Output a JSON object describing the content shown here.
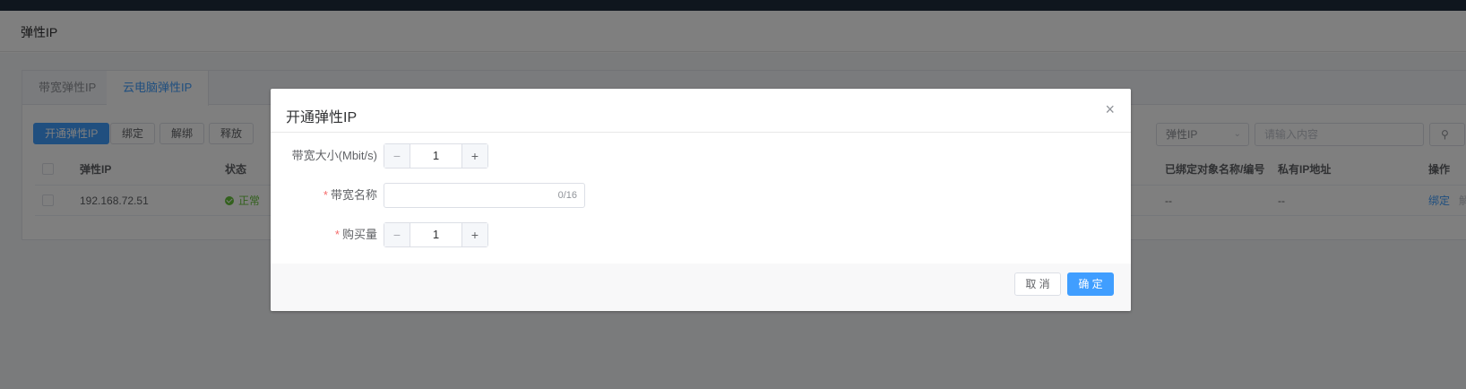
{
  "page": {
    "title": "弹性IP"
  },
  "tabs": [
    {
      "label": "带宽弹性IP",
      "active": false
    },
    {
      "label": "云电脑弹性IP",
      "active": true
    }
  ],
  "toolbar": {
    "open_label": "开通弹性IP",
    "bind_label": "绑定",
    "unbind_label": "解绑",
    "release_label": "释放"
  },
  "filter": {
    "select_value": "弹性IP",
    "search_placeholder": "请输入内容"
  },
  "table": {
    "headers": {
      "ip": "弹性IP",
      "status": "状态",
      "bound_object": "已绑定对象名称/编号",
      "private_ip": "私有IP地址",
      "actions": "操作"
    },
    "rows": [
      {
        "ip": "192.168.72.51",
        "status": "正常",
        "bound_object": "--",
        "private_ip": "--",
        "action_bind": "绑定",
        "action_unbind": "解绑"
      }
    ]
  },
  "dialog": {
    "title": "开通弹性IP",
    "bandwidth_label": "带宽大小(Mbit/s)",
    "bandwidth_value": "1",
    "name_label": "带宽名称",
    "name_value": "",
    "name_counter": "0/16",
    "quantity_label": "购买量",
    "quantity_value": "1",
    "cancel_label": "取 消",
    "confirm_label": "确 定"
  },
  "colors": {
    "primary": "#409eff",
    "success": "#67c23a",
    "required": "#f56c6c"
  }
}
